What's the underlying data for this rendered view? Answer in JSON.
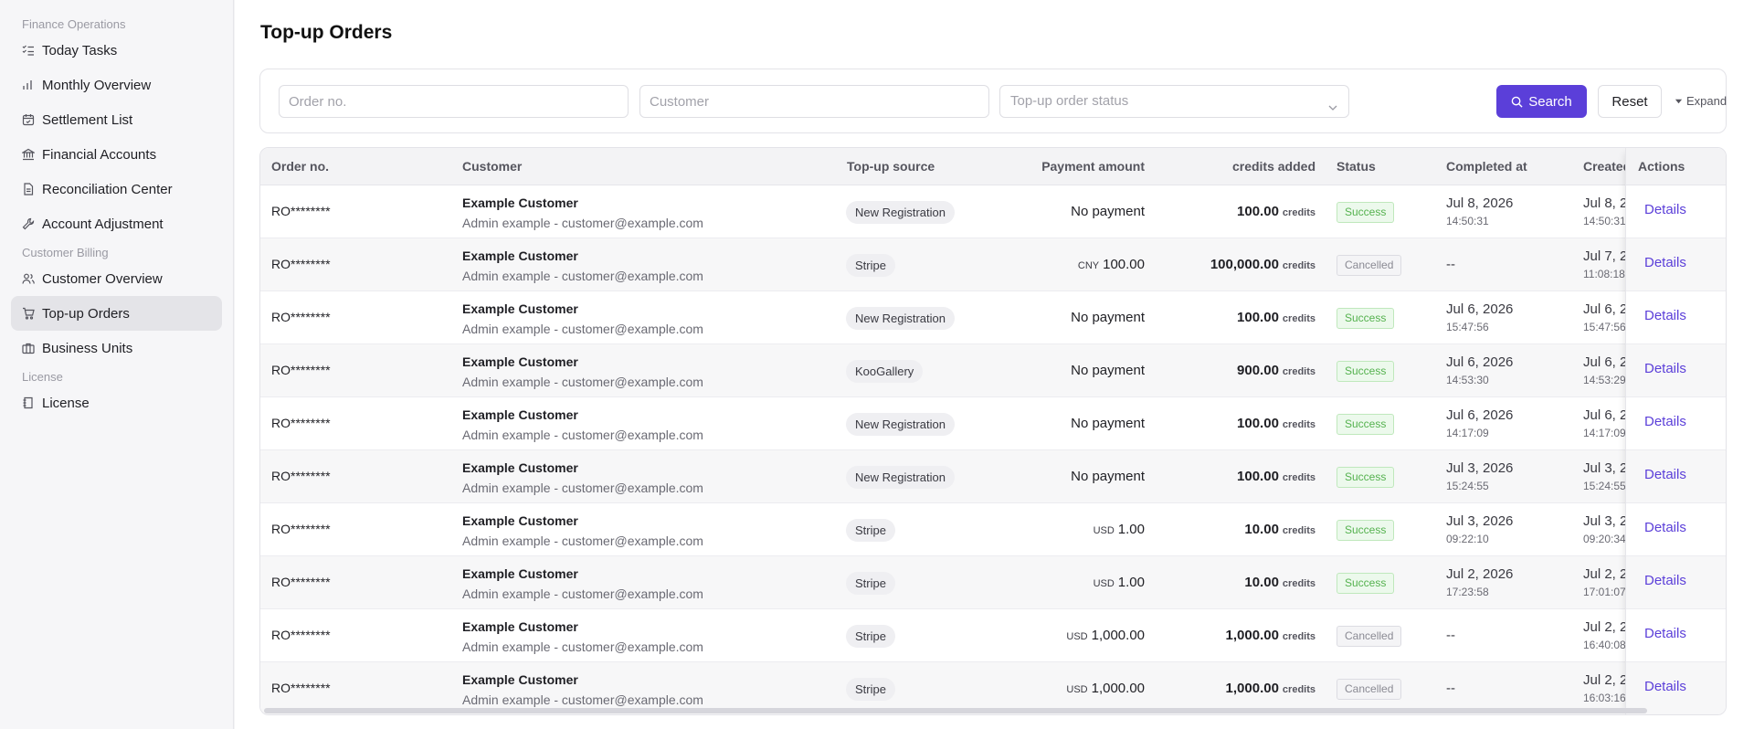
{
  "sidebar": {
    "groups": [
      {
        "label": "Finance Operations",
        "items": [
          "Today Tasks",
          "Monthly Overview",
          "Settlement List",
          "Financial Accounts",
          "Reconciliation Center",
          "Account Adjustment"
        ]
      },
      {
        "label": "Customer Billing",
        "items": [
          "Customer Overview",
          "Top-up Orders",
          "Business Units"
        ]
      },
      {
        "label": "License",
        "items": [
          "License"
        ]
      }
    ],
    "active_item": "Top-up Orders"
  },
  "page": {
    "title": "Top-up Orders"
  },
  "filters": {
    "order_placeholder": "Order no.",
    "customer_placeholder": "Customer",
    "status_placeholder": "Top-up order status",
    "search_label": "Search",
    "reset_label": "Reset",
    "expand_label": "Expand"
  },
  "table": {
    "headers": {
      "order": "Order no.",
      "customer": "Customer",
      "source": "Top-up source",
      "payment": "Payment amount",
      "credits": "credits added",
      "status": "Status",
      "completed": "Completed at",
      "created": "Created",
      "actions": "Actions"
    },
    "credits_unit": "credits",
    "details_label": "Details",
    "rows": [
      {
        "order": "RO********",
        "customer": "Example Customer",
        "customer_sub": "Admin example - customer@example.com",
        "source": "New Registration",
        "pay_currency": "",
        "pay_amount": "No payment",
        "credits": "100.00",
        "status": "Success",
        "completed_date": "Jul 8, 2026",
        "completed_time": "14:50:31",
        "created_date": "Jul 8, 2",
        "created_time": "14:50:31"
      },
      {
        "order": "RO********",
        "customer": "Example Customer",
        "customer_sub": "Admin example - customer@example.com",
        "source": "Stripe",
        "pay_currency": "CNY",
        "pay_amount": "100.00",
        "credits": "100,000.00",
        "status": "Cancelled",
        "completed_date": "--",
        "completed_time": "",
        "created_date": "Jul 7, 2(",
        "created_time": "11:08:18"
      },
      {
        "order": "RO********",
        "customer": "Example Customer",
        "customer_sub": "Admin example - customer@example.com",
        "source": "New Registration",
        "pay_currency": "",
        "pay_amount": "No payment",
        "credits": "100.00",
        "status": "Success",
        "completed_date": "Jul 6, 2026",
        "completed_time": "15:47:56",
        "created_date": "Jul 6, 2",
        "created_time": "15:47:56"
      },
      {
        "order": "RO********",
        "customer": "Example Customer",
        "customer_sub": "Admin example - customer@example.com",
        "source": "KooGallery",
        "pay_currency": "",
        "pay_amount": "No payment",
        "credits": "900.00",
        "status": "Success",
        "completed_date": "Jul 6, 2026",
        "completed_time": "14:53:30",
        "created_date": "Jul 6, 2",
        "created_time": "14:53:29"
      },
      {
        "order": "RO********",
        "customer": "Example Customer",
        "customer_sub": "Admin example - customer@example.com",
        "source": "New Registration",
        "pay_currency": "",
        "pay_amount": "No payment",
        "credits": "100.00",
        "status": "Success",
        "completed_date": "Jul 6, 2026",
        "completed_time": "14:17:09",
        "created_date": "Jul 6, 2",
        "created_time": "14:17:09"
      },
      {
        "order": "RO********",
        "customer": "Example Customer",
        "customer_sub": "Admin example - customer@example.com",
        "source": "New Registration",
        "pay_currency": "",
        "pay_amount": "No payment",
        "credits": "100.00",
        "status": "Success",
        "completed_date": "Jul 3, 2026",
        "completed_time": "15:24:55",
        "created_date": "Jul 3, 2",
        "created_time": "15:24:55"
      },
      {
        "order": "RO********",
        "customer": "Example Customer",
        "customer_sub": "Admin example - customer@example.com",
        "source": "Stripe",
        "pay_currency": "USD",
        "pay_amount": "1.00",
        "credits": "10.00",
        "status": "Success",
        "completed_date": "Jul 3, 2026",
        "completed_time": "09:22:10",
        "created_date": "Jul 3, 2",
        "created_time": "09:20:34"
      },
      {
        "order": "RO********",
        "customer": "Example Customer",
        "customer_sub": "Admin example - customer@example.com",
        "source": "Stripe",
        "pay_currency": "USD",
        "pay_amount": "1.00",
        "credits": "10.00",
        "status": "Success",
        "completed_date": "Jul 2, 2026",
        "completed_time": "17:23:58",
        "created_date": "Jul 2, 2",
        "created_time": "17:01:07"
      },
      {
        "order": "RO********",
        "customer": "Example Customer",
        "customer_sub": "Admin example - customer@example.com",
        "source": "Stripe",
        "pay_currency": "USD",
        "pay_amount": "1,000.00",
        "credits": "1,000.00",
        "status": "Cancelled",
        "completed_date": "--",
        "completed_time": "",
        "created_date": "Jul 2, 2",
        "created_time": "16:40:08"
      },
      {
        "order": "RO********",
        "customer": "Example Customer",
        "customer_sub": "Admin example - customer@example.com",
        "source": "Stripe",
        "pay_currency": "USD",
        "pay_amount": "1,000.00",
        "credits": "1,000.00",
        "status": "Cancelled",
        "completed_date": "--",
        "completed_time": "",
        "created_date": "Jul 2, 2",
        "created_time": "16:03:16"
      }
    ]
  },
  "colors": {
    "accent": "#5b3fd9",
    "success": "#55b24f",
    "cancelled": "#8a8a93"
  }
}
